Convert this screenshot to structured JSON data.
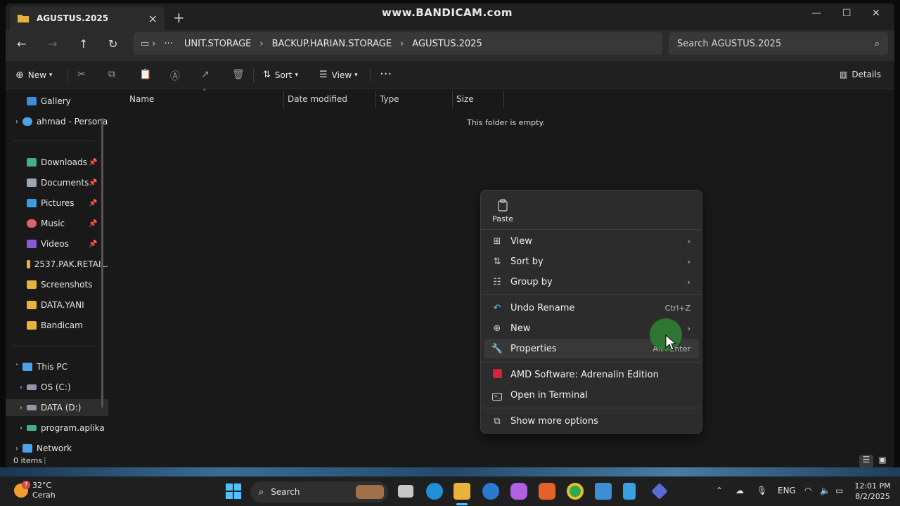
{
  "watermark": "www.BANDICAM.com",
  "tab": {
    "title": "AGUSTUS.2025"
  },
  "breadcrumbs": [
    "UNIT.STORAGE",
    "BACKUP.HARIAN.STORAGE",
    "AGUSTUS.2025"
  ],
  "search_placeholder": "Search AGUSTUS.2025",
  "command_bar": {
    "new": "New",
    "sort": "Sort",
    "view": "View",
    "details": "Details"
  },
  "sidebar": {
    "gallery": "Gallery",
    "onedrive": "ahmad - Persona",
    "quick": [
      {
        "label": "Downloads",
        "icon": "download-icon",
        "pinned": true
      },
      {
        "label": "Documents",
        "icon": "document-icon",
        "pinned": true
      },
      {
        "label": "Pictures",
        "icon": "pictures-icon",
        "pinned": true
      },
      {
        "label": "Music",
        "icon": "music-icon",
        "pinned": true
      },
      {
        "label": "Videos",
        "icon": "videos-icon",
        "pinned": true
      },
      {
        "label": "2537.PAK.RETAIL.",
        "icon": "folder-icon",
        "pinned": false
      },
      {
        "label": "Screenshots",
        "icon": "folder-icon",
        "pinned": false
      },
      {
        "label": "DATA.YANI",
        "icon": "folder-icon",
        "pinned": false
      },
      {
        "label": "Bandicam",
        "icon": "folder-icon",
        "pinned": false
      }
    ],
    "this_pc": "This PC",
    "drives": [
      "OS (C:)",
      "DATA (D:)",
      "program.aplika"
    ],
    "network": "Network"
  },
  "columns": [
    "Name",
    "Date modified",
    "Type",
    "Size"
  ],
  "empty_message": "This folder is empty.",
  "status": {
    "items": "0 items"
  },
  "context_menu": {
    "paste": "Paste",
    "items": [
      {
        "label": "View",
        "icon": "grid-icon",
        "submenu": true
      },
      {
        "label": "Sort by",
        "icon": "sort-icon",
        "submenu": true
      },
      {
        "label": "Group by",
        "icon": "group-icon",
        "submenu": true
      },
      {
        "label": "Undo Rename",
        "icon": "undo-icon",
        "shortcut": "Ctrl+Z"
      },
      {
        "label": "New",
        "icon": "plus-circle-icon",
        "submenu": true
      },
      {
        "label": "Properties",
        "icon": "wrench-icon",
        "shortcut": "Alt+Enter"
      },
      {
        "label": "AMD Software: Adrenalin Edition",
        "icon": "amd-icon"
      },
      {
        "label": "Open in Terminal",
        "icon": "terminal-icon"
      },
      {
        "label": "Show more options",
        "icon": "external-icon"
      }
    ]
  },
  "taskbar": {
    "weather_temp": "32°C",
    "weather_desc": "Cerah",
    "weather_badge": "7",
    "search": "Search",
    "lang": "ENG",
    "time": "12:01 PM",
    "date": "8/2/2025"
  },
  "colors": {
    "accent": "#4cc2ff",
    "folder": "#e8b33b",
    "cursor_halo": "#2e7d32"
  }
}
